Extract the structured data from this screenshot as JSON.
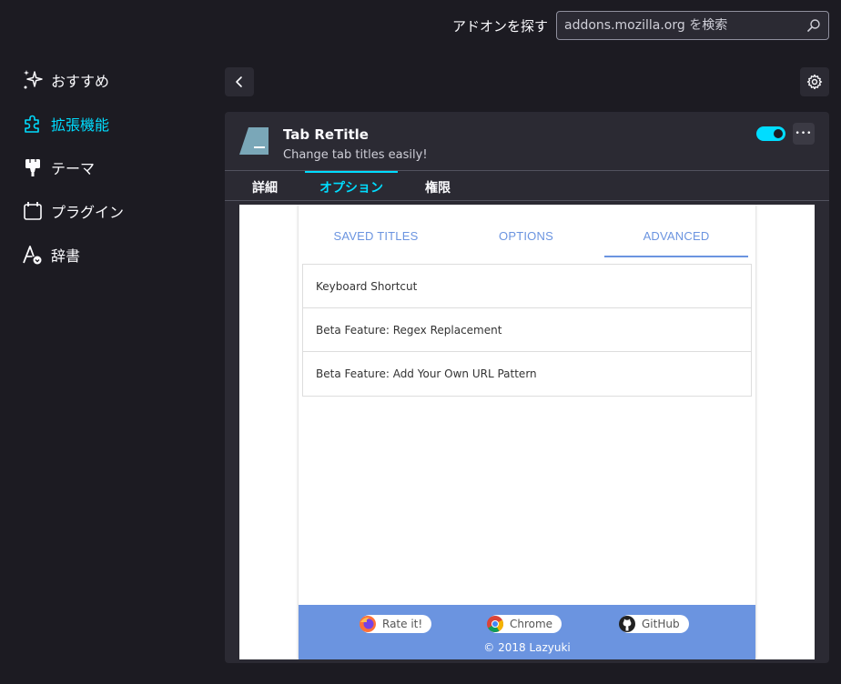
{
  "header": {
    "find_label": "アドオンを探す",
    "search_placeholder": "addons.mozilla.org を検索"
  },
  "sidebar": {
    "items": [
      {
        "label": "おすすめ",
        "icon": "sparkle-icon"
      },
      {
        "label": "拡張機能",
        "icon": "puzzle-icon",
        "active": true
      },
      {
        "label": "テーマ",
        "icon": "brush-icon"
      },
      {
        "label": "プラグイン",
        "icon": "plugin-icon"
      },
      {
        "label": "辞書",
        "icon": "dictionary-icon"
      }
    ]
  },
  "addon": {
    "name": "Tab ReTitle",
    "description": "Change tab titles easily!",
    "enabled": true,
    "more_label": "•••",
    "tabs": [
      {
        "label": "詳細"
      },
      {
        "label": "オプション",
        "active": true
      },
      {
        "label": "権限"
      }
    ]
  },
  "options_page": {
    "tabs": [
      {
        "label": "SAVED TITLES"
      },
      {
        "label": "OPTIONS"
      },
      {
        "label": "ADVANCED",
        "active": true
      }
    ],
    "items": [
      "Keyboard Shortcut",
      "Beta Feature: Regex Replacement",
      "Beta Feature: Add Your Own URL Pattern"
    ],
    "footer": {
      "links": [
        {
          "label": "Rate it!",
          "icon": "firefox-icon"
        },
        {
          "label": "Chrome",
          "icon": "chrome-icon"
        },
        {
          "label": "GitHub",
          "icon": "github-icon"
        }
      ],
      "copyright": "© 2018 Lazyuki"
    }
  },
  "colors": {
    "accent": "#00ddff",
    "background": "#1c1b22",
    "card": "#2b2a33",
    "options_blue": "#6b94e0"
  }
}
